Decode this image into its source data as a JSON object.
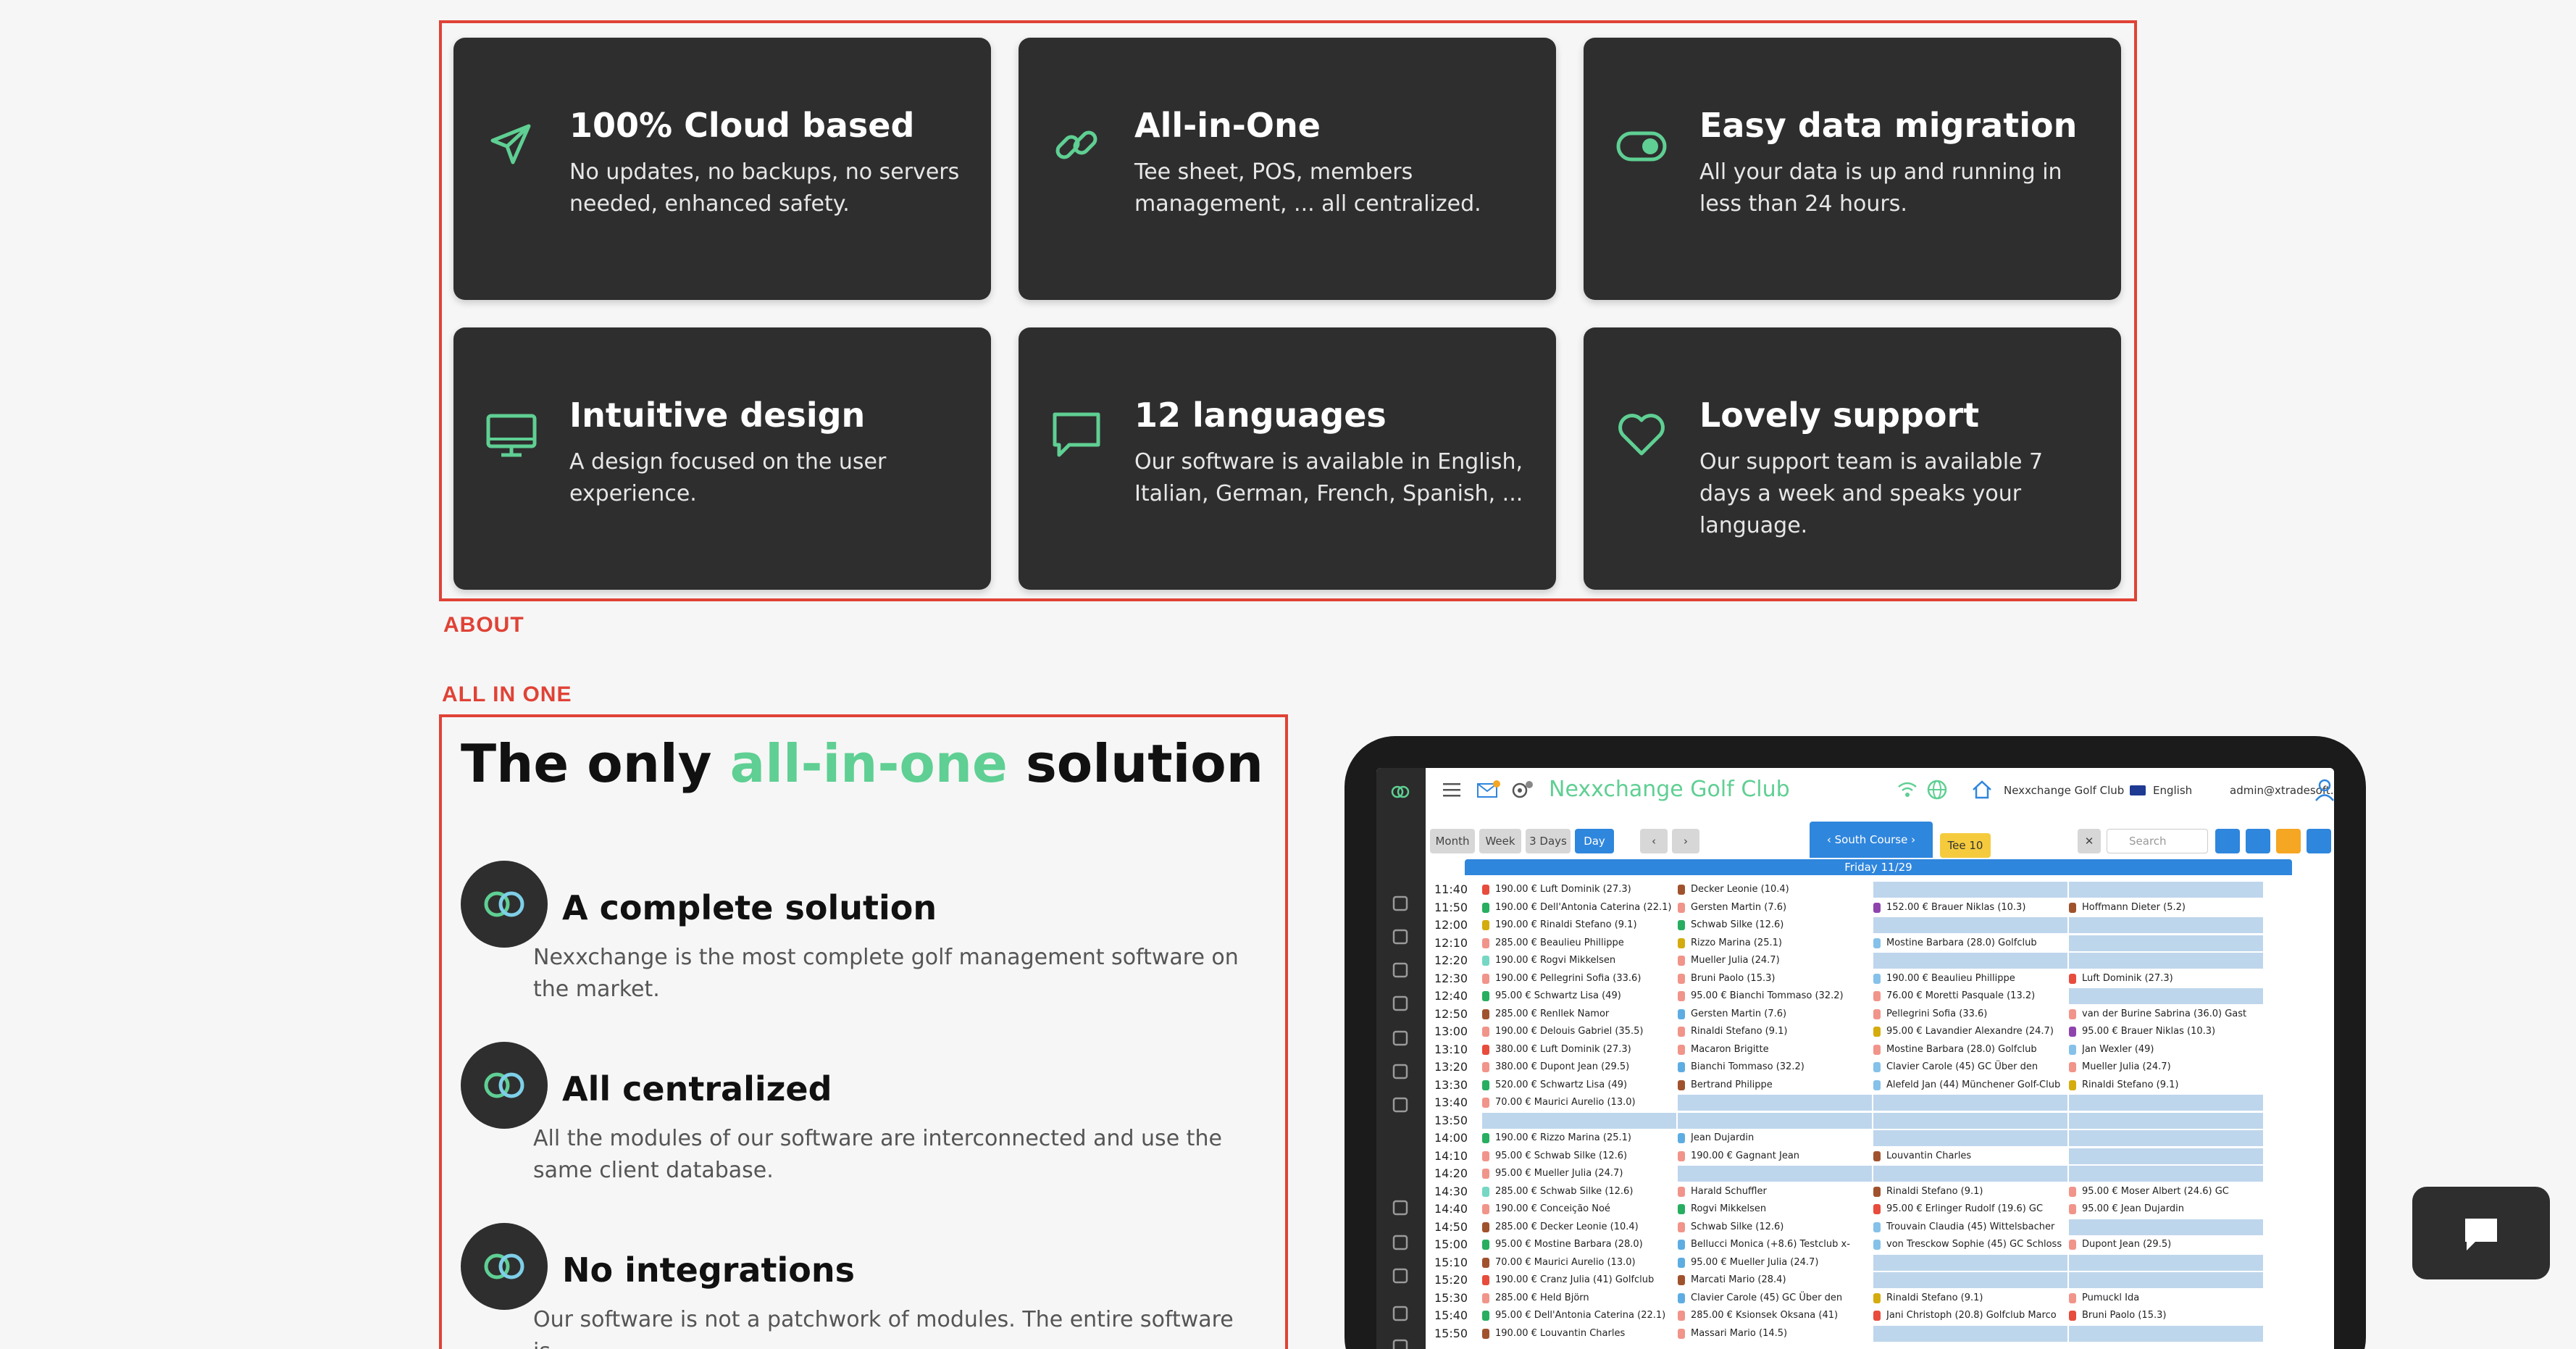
{
  "features": [
    {
      "title": "100% Cloud based",
      "desc": "No updates, no backups, no servers needed, enhanced safety.",
      "icon": "send-icon"
    },
    {
      "title": "All-in-One",
      "desc": "Tee sheet, POS, members management, ... all centralized.",
      "icon": "link-icon"
    },
    {
      "title": "Easy data migration",
      "desc": "All your data is up and running in less than 24 hours.",
      "icon": "toggle-icon"
    },
    {
      "title": "Intuitive design",
      "desc": "A design focused on the user experience.",
      "icon": "monitor-icon"
    },
    {
      "title": "12 languages",
      "desc": "Our software is available in English, Italian, German, French, Spanish, ...",
      "icon": "chat-bubble-icon"
    },
    {
      "title": "Lovely support",
      "desc": "Our support team is available 7 days a week and speaks your language.",
      "icon": "heart-icon"
    }
  ],
  "labels": {
    "about": "ABOUT",
    "all_in_one": "ALL IN ONE"
  },
  "solution": {
    "title_pre": "The only ",
    "title_accent": "all-in-one",
    "title_post": " solution",
    "items": [
      {
        "title": "A complete solution",
        "desc": "Nexxchange is the most complete golf management software on the market."
      },
      {
        "title": "All centralized",
        "desc": "All the modules of our software are interconnected and use the same client database."
      },
      {
        "title": "No integrations",
        "desc": "Our software is not a patchwork of modules. The entire software is"
      }
    ]
  },
  "app": {
    "title": "Nexxchange Golf Club",
    "club": "Nexxchange Golf Club",
    "language": "English",
    "user": "admin@xtradesoft.com",
    "views": [
      "Month",
      "Week",
      "3 Days",
      "Day"
    ],
    "course": "South Course",
    "tee": "Tee 10",
    "search_placeholder": "Search",
    "day": "Friday 11/29",
    "colors": {
      "accent": "#5fcf93",
      "blue": "#2f86dd",
      "empty": "#bed6ec"
    },
    "rows": [
      {
        "time": "11:40",
        "cells": [
          [
            "#e74c3c",
            "190.00 € Luft Dominik (27.3)"
          ],
          [
            "#a0522d",
            "Decker Leonie (10.4)"
          ],
          null,
          null
        ]
      },
      {
        "time": "11:50",
        "cells": [
          [
            "#27ae60",
            "190.00 € Dell'Antonia Caterina (22.1)"
          ],
          [
            "#f1948a",
            "Gersten Martin (7.6)"
          ],
          [
            "#8e44ad",
            "152.00 € Brauer Niklas (10.3)"
          ],
          [
            "#a0522d",
            "Hoffmann Dieter (5.2)"
          ]
        ]
      },
      {
        "time": "12:00",
        "cells": [
          [
            "#d4ac0d",
            "190.00 € Rinaldi Stefano (9.1)"
          ],
          [
            "#27ae60",
            "Schwab Silke (12.6)"
          ],
          null,
          null
        ]
      },
      {
        "time": "12:10",
        "cells": [
          [
            "#f1948a",
            "285.00 € Beaulieu Phillippe"
          ],
          [
            "#d4ac0d",
            "Rizzo Marina (25.1)"
          ],
          [
            "#85c1e9",
            "Mostine Barbara (28.0) Golfclub"
          ],
          null
        ]
      },
      {
        "time": "12:20",
        "cells": [
          [
            "#76d7c4",
            "190.00 € Rogvi Mikkelsen"
          ],
          [
            "#f1948a",
            "Mueller Julia (24.7)"
          ],
          null,
          null
        ]
      },
      {
        "time": "12:30",
        "cells": [
          [
            "#f1948a",
            "190.00 € Pellegrini Sofia (33.6)"
          ],
          [
            "#f1948a",
            "Bruni Paolo (15.3)"
          ],
          [
            "#85c1e9",
            "190.00 € Beaulieu Phillippe"
          ],
          [
            "#e74c3c",
            "Luft Dominik (27.3)"
          ]
        ]
      },
      {
        "time": "12:40",
        "cells": [
          [
            "#27ae60",
            "95.00 € Schwartz Lisa (49)"
          ],
          [
            "#f1948a",
            "95.00 € Bianchi Tommaso (32.2)"
          ],
          [
            "#f1948a",
            "76.00 € Moretti Pasquale (13.2)"
          ],
          null
        ]
      },
      {
        "time": "12:50",
        "cells": [
          [
            "#a0522d",
            "285.00 € Renllek Namor"
          ],
          [
            "#5dade2",
            "Gersten Martin (7.6)"
          ],
          [
            "#f1948a",
            "Pellegrini Sofia (33.6)"
          ],
          [
            "#f1948a",
            "van der Burine Sabrina (36.0) Gast"
          ]
        ]
      },
      {
        "time": "13:00",
        "cells": [
          [
            "#f1948a",
            "190.00 € Delouis Gabriel (35.5)"
          ],
          [
            "#f1948a",
            "Rinaldi Stefano (9.1)"
          ],
          [
            "#d4ac0d",
            "95.00 € Lavandier Alexandre (24.7)"
          ],
          [
            "#8e44ad",
            "95.00 € Brauer Niklas (10.3)"
          ]
        ]
      },
      {
        "time": "13:10",
        "cells": [
          [
            "#e74c3c",
            "380.00 € Luft Dominik (27.3)"
          ],
          [
            "#f1948a",
            "Macaron Brigitte"
          ],
          [
            "#f1948a",
            "Mostine Barbara (28.0) Golfclub"
          ],
          [
            "#85c1e9",
            "Jan Wexler (49)"
          ]
        ]
      },
      {
        "time": "13:20",
        "cells": [
          [
            "#f1948a",
            "380.00 € Dupont Jean (29.5)"
          ],
          [
            "#5dade2",
            "Bianchi Tommaso (32.2)"
          ],
          [
            "#85c1e9",
            "Clavier Carole (45) GC Über den"
          ],
          [
            "#f1948a",
            "Mueller Julia (24.7)"
          ]
        ]
      },
      {
        "time": "13:30",
        "cells": [
          [
            "#27ae60",
            "520.00 € Schwartz Lisa (49)"
          ],
          [
            "#a0522d",
            "Bertrand Philippe"
          ],
          [
            "#85c1e9",
            "Alefeld Jan (44) Münchener Golf-Club"
          ],
          [
            "#d4ac0d",
            "Rinaldi Stefano (9.1)"
          ]
        ]
      },
      {
        "time": "13:40",
        "cells": [
          [
            "#f1948a",
            "70.00 € Maurici Aurelio (13.0)"
          ],
          null,
          null,
          null
        ]
      },
      {
        "time": "13:50",
        "cells": [
          null,
          null,
          null,
          null
        ]
      },
      {
        "time": "14:00",
        "cells": [
          [
            "#27ae60",
            "190.00 € Rizzo Marina (25.1)"
          ],
          [
            "#5dade2",
            "Jean Dujardin"
          ],
          null,
          null
        ]
      },
      {
        "time": "14:10",
        "cells": [
          [
            "#f1948a",
            "95.00 € Schwab Silke (12.6)"
          ],
          [
            "#f1948a",
            "190.00 € Gagnant Jean"
          ],
          [
            "#a0522d",
            "Louvantin Charles"
          ],
          null
        ]
      },
      {
        "time": "14:20",
        "cells": [
          [
            "#f1948a",
            "95.00 € Mueller Julia (24.7)"
          ],
          null,
          null,
          null
        ]
      },
      {
        "time": "14:30",
        "cells": [
          [
            "#76d7c4",
            "285.00 € Schwab Silke (12.6)"
          ],
          [
            "#f1948a",
            "Harald Schuffler"
          ],
          [
            "#a0522d",
            "Rinaldi Stefano (9.1)"
          ],
          [
            "#f1948a",
            "95.00 € Moser Albert (24.6) GC"
          ]
        ]
      },
      {
        "time": "14:40",
        "cells": [
          [
            "#f1948a",
            "190.00 € Conceição Noé"
          ],
          [
            "#27ae60",
            "Rogvi Mikkelsen"
          ],
          [
            "#e74c3c",
            "95.00 € Erlinger Rudolf (19.6) GC"
          ],
          [
            "#f1948a",
            "95.00 € Jean Dujardin"
          ]
        ]
      },
      {
        "time": "14:50",
        "cells": [
          [
            "#a0522d",
            "285.00 € Decker Leonie (10.4)"
          ],
          [
            "#f1948a",
            "Schwab Silke (12.6)"
          ],
          [
            "#85c1e9",
            "Trouvain Claudia (45) Wittelsbacher"
          ],
          null
        ]
      },
      {
        "time": "15:00",
        "cells": [
          [
            "#27ae60",
            "95.00 € Mostine Barbara (28.0)"
          ],
          [
            "#5dade2",
            "Bellucci Monica (+8.6) Testclub x-"
          ],
          [
            "#85c1e9",
            "von Tresckow Sophie (45) GC Schloss"
          ],
          [
            "#f1948a",
            "Dupont Jean (29.5)"
          ]
        ]
      },
      {
        "time": "15:10",
        "cells": [
          [
            "#a0522d",
            "70.00 € Maurici Aurelio (13.0)"
          ],
          [
            "#5dade2",
            "95.00 € Mueller Julia (24.7)"
          ],
          null,
          null
        ]
      },
      {
        "time": "15:20",
        "cells": [
          [
            "#e74c3c",
            "190.00 € Cranz Julia (41) Golfclub"
          ],
          [
            "#a0522d",
            "Marcati Mario (28.4)"
          ],
          null,
          null
        ]
      },
      {
        "time": "15:30",
        "cells": [
          [
            "#f1948a",
            "285.00 € Held Björn"
          ],
          [
            "#5dade2",
            "Clavier Carole (45) GC Über den"
          ],
          [
            "#d4ac0d",
            "Rinaldi Stefano (9.1)"
          ],
          [
            "#f1948a",
            "Pumuckl Ida"
          ]
        ]
      },
      {
        "time": "15:40",
        "cells": [
          [
            "#27ae60",
            "95.00 € Dell'Antonia Caterina (22.1)"
          ],
          [
            "#f1948a",
            "285.00 € Ksionsek Oksana (41)"
          ],
          [
            "#e74c3c",
            "Jani Christoph (20.8) Golfclub Marco"
          ],
          [
            "#e74c3c",
            "Bruni Paolo (15.3)"
          ]
        ]
      },
      {
        "time": "15:50",
        "cells": [
          [
            "#a0522d",
            "190.00 € Louvantin Charles"
          ],
          [
            "#f1948a",
            "Massari Mario (14.5)"
          ],
          null,
          null
        ]
      }
    ]
  }
}
